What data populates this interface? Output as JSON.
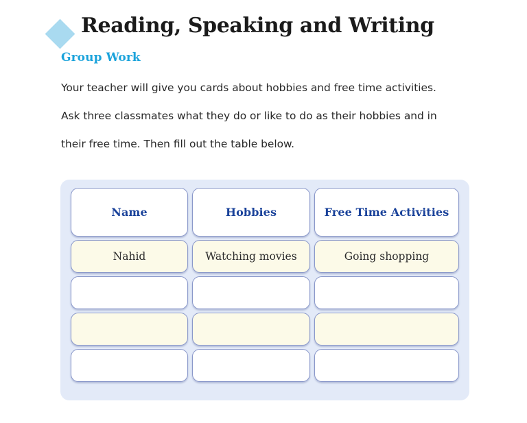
{
  "header": {
    "bullet_icon": "diamond-icon",
    "title": "Reading, Speaking and Writing",
    "subheading": "Group Work"
  },
  "instructions": {
    "lines": [
      "Your teacher will give you cards about hobbies and free time activities.",
      "Ask three classmates what they do or like to do as their hobbies and in",
      "their free time. Then fill out the table below."
    ]
  },
  "colors": {
    "diamond": "#a9daf0",
    "title": "#1b1b1b",
    "subheading": "#1ba3db",
    "table_header_text": "#1a429a",
    "panel_background": "#e3eaf8",
    "cell_border": "#8a98ca",
    "cell_shaded": "#fcfae8",
    "cell_plain": "#ffffff",
    "body_text": "#272727"
  },
  "table": {
    "columns": [
      "Name",
      "Hobbies",
      "Free Time Activities"
    ],
    "rows": [
      {
        "shaded": true,
        "cells": [
          "Nahid",
          "Watching movies",
          "Going shopping"
        ]
      },
      {
        "shaded": false,
        "cells": [
          "",
          "",
          ""
        ]
      },
      {
        "shaded": true,
        "cells": [
          "",
          "",
          ""
        ]
      },
      {
        "shaded": false,
        "cells": [
          "",
          "",
          ""
        ]
      }
    ]
  }
}
